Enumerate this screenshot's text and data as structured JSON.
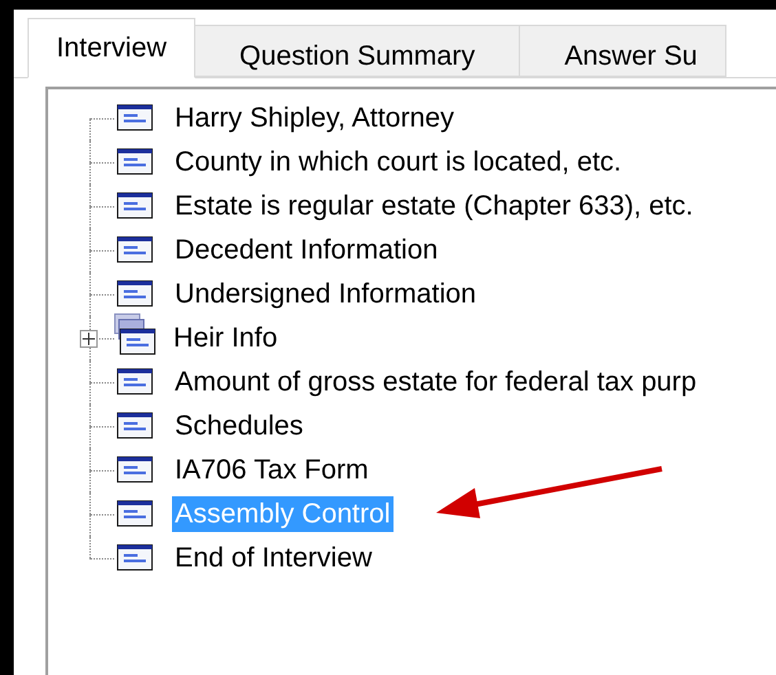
{
  "tabs": [
    {
      "label": "Interview",
      "selected": true
    },
    {
      "label": "Question Summary",
      "selected": false
    },
    {
      "label": "Answer Su",
      "selected": false
    }
  ],
  "tree": {
    "items": [
      {
        "kind": "dialog",
        "label": "Harry Shipley, Attorney",
        "selected": false
      },
      {
        "kind": "dialog",
        "label": "County in which court is located, etc.",
        "selected": false
      },
      {
        "kind": "dialog",
        "label": "Estate is regular estate (Chapter 633), etc.",
        "selected": false
      },
      {
        "kind": "dialog",
        "label": "Decedent Information",
        "selected": false
      },
      {
        "kind": "dialog",
        "label": "Undersigned Information",
        "selected": false
      },
      {
        "kind": "group",
        "label": "Heir Info",
        "selected": false,
        "expanded": false
      },
      {
        "kind": "dialog",
        "label": "Amount of gross estate for federal tax purp",
        "selected": false
      },
      {
        "kind": "dialog",
        "label": "Schedules",
        "selected": false
      },
      {
        "kind": "dialog",
        "label": "IA706 Tax Form",
        "selected": false
      },
      {
        "kind": "dialog",
        "label": "Assembly Control",
        "selected": true
      },
      {
        "kind": "dialog",
        "label": "End of Interview",
        "selected": false
      }
    ]
  }
}
